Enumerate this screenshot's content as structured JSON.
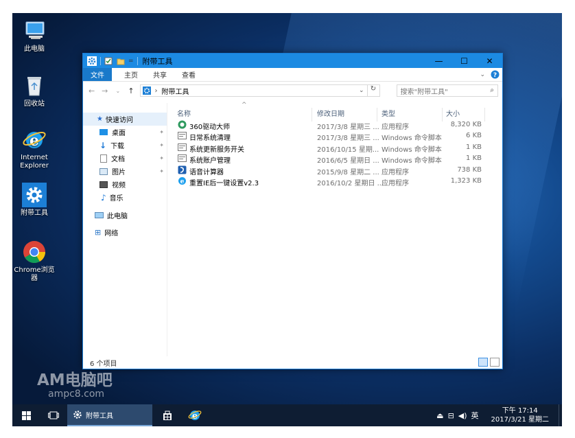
{
  "desktop": {
    "icons": [
      {
        "label": "此电脑"
      },
      {
        "label": "回收站"
      },
      {
        "label": "Internet Explorer"
      },
      {
        "label": "附带工具"
      },
      {
        "label": "Chrome浏览器"
      }
    ]
  },
  "window": {
    "title": "附带工具",
    "quick_access_down": "=",
    "ribbon_tabs": [
      "文件",
      "主页",
      "共享",
      "查看"
    ],
    "address": {
      "separator": "›",
      "path": "附带工具"
    },
    "search_placeholder": "搜索\"附带工具\"",
    "nav": {
      "quick_access": "快速访问",
      "items": [
        "桌面",
        "下载",
        "文档",
        "图片",
        "视频",
        "音乐"
      ],
      "this_pc": "此电脑",
      "network": "网络"
    },
    "columns": {
      "name": "名称",
      "date": "修改日期",
      "type": "类型",
      "size": "大小"
    },
    "files": [
      {
        "name": "360驱动大师",
        "date": "2017/3/8 星期三 ...",
        "type": "应用程序",
        "size": "8,320 KB",
        "icon": "driver-app-icon"
      },
      {
        "name": "日常系统清理",
        "date": "2017/3/8 星期三 ...",
        "type": "Windows 命令脚本",
        "size": "6 KB",
        "icon": "cmd-script-icon"
      },
      {
        "name": "系统更新服务开关",
        "date": "2016/10/15 星期...",
        "type": "Windows 命令脚本",
        "size": "1 KB",
        "icon": "cmd-script-icon"
      },
      {
        "name": "系统账户管理",
        "date": "2016/6/5 星期日 ...",
        "type": "Windows 命令脚本",
        "size": "1 KB",
        "icon": "cmd-script-icon"
      },
      {
        "name": "语音计算器",
        "date": "2015/9/8 星期二 ...",
        "type": "应用程序",
        "size": "738 KB",
        "icon": "calculator-app-icon"
      },
      {
        "name": "重置IE后一键设置v2.3",
        "date": "2016/10/2 星期日 ...",
        "type": "应用程序",
        "size": "1,323 KB",
        "icon": "ie-app-icon"
      }
    ],
    "status": "6 个项目"
  },
  "watermark": {
    "line1": "AM电脑吧",
    "line2": "ampc8.com"
  },
  "taskbar": {
    "active_app": "附带工具",
    "ime": "英",
    "time": "下午 17:14",
    "date": "2017/3/21 星期二"
  },
  "colors": {
    "accent": "#1c8ae2",
    "file_tab": "#1979ca",
    "taskbar": "#0e1d33"
  }
}
